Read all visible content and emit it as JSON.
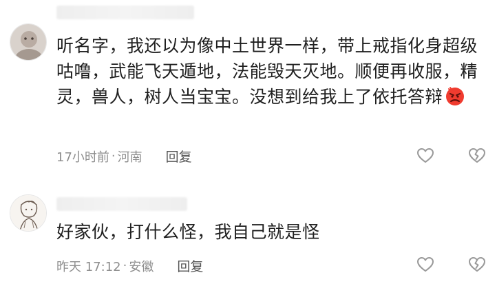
{
  "comments": [
    {
      "text": "听名字，我还以为像中土世界一样，带上戒指化身超级咕噜，武能飞天遁地，法能毁天灭地。顺便再收服，精灵，兽人，树人当宝宝。没想到给我上了依托答辩",
      "emoji": "angry-face",
      "time": "17小时前",
      "separator": "·",
      "location": "河南",
      "reply_label": "回复",
      "like_icon": "heart-outline-icon",
      "dislike_icon": "broken-heart-outline-icon"
    },
    {
      "text": "好家伙，打什么怪，我自己就是怪",
      "time": "昨天 17:12",
      "separator": "·",
      "location": "安徽",
      "reply_label": "回复",
      "like_icon": "heart-outline-icon",
      "dislike_icon": "broken-heart-outline-icon"
    }
  ],
  "colors": {
    "text": "#1f1f1f",
    "meta": "#8e8e8e",
    "reply": "#555555",
    "icon": "#9a9a9a"
  }
}
